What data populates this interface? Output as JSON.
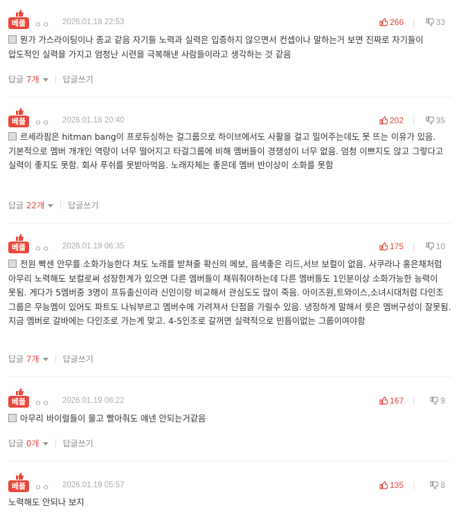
{
  "comments": [
    {
      "badge": "베플",
      "nick": "ㅇㅇ",
      "date": "2026.01.18 22:53",
      "up": "266",
      "down": "33",
      "text": "뭔가 가스라이팅이나 종교 같음 자기들 노력과 실력은 입증하지 않으면서 컨셉이나 말하는거 보면 진짜로 자기들이 압도적인 실력을 가지고 엄청난 시련을 극복해낸 사람들이라고 생각하는 것 같음",
      "reply_label": "답글",
      "reply_count": "7개",
      "write_label": "답글쓰기"
    },
    {
      "badge": "베플",
      "nick": "ㅇㅇ",
      "date": "2026.01.18 20:40",
      "up": "202",
      "down": "35",
      "text": "르세라핌은 hitman bang이 프로듀싱하는 걸그룹으로 하이브에서도 사활을 걸고 밀어주는데도 못 뜨는 이유가 있음. 기본적으로 멤버 개개인 역량이 너무 떨어지고 타걸그룹에 비해 멤버들이 경쟁성이 너무 없음. 엄청 이쁘지도 않고 그렇다고 실력이 좋지도 못함. 회사 푸쉬를 못받아먹음. 노래자체는 좋은데 멤버 반이상이 소화를 못함",
      "reply_label": "답글",
      "reply_count": "22개",
      "write_label": "답글쓰기"
    },
    {
      "badge": "베플",
      "nick": "ㅇㅇ",
      "date": "2026.01.19 06:35",
      "up": "175",
      "down": "10",
      "text": "전원 빡센 안무를 소화가능한다 쳐도 노래를 받쳐줄 확신의 메보, 음색좋은 리드,서브 보컬이 없음. 사쿠라나 홍은채처럼 아무리 노력해도 보컬로써 성장한계가 있으면 다른 멤버들이 채워줘야하는데 다른 멤버들도 1인분이상 소화가능한 능력이 못됨. 게다가 5멤버중 3명이 프듀출신이라 신인이랑 비교해서 관심도도 많이 죽음. 아이즈원,트와이스,소녀시대처럼 다인조 그룹은 무능멤이 있어도 파트도 나눠부르고 멤버수에 가려져서 단점을 가릴수 있음. 냉정하게 말해서 릇은 멤버구성이 잘못됨. 지금 멤버로 갈바에는 다인조로 가는게 맞고. 4-5인조로 갈꺼면 실력적으로 빈틈이없는 그룹이여야함",
      "reply_label": "답글",
      "reply_count": "7개",
      "write_label": "답글쓰기"
    },
    {
      "badge": "베플",
      "nick": "ㅇㅇ",
      "date": "2026.01.19 08:22",
      "up": "167",
      "down": "9",
      "text": "아무리 바이럴들이 물고 빨아줘도 얘넨 안되는거같음",
      "reply_label": "답글",
      "reply_count": "0개",
      "write_label": "답글쓰기"
    },
    {
      "badge": "베플",
      "nick": "ㅇㅇ",
      "date": "2026.01.19 05:57",
      "up": "135",
      "down": "8",
      "text": "노력해도 안되나 보지"
    }
  ],
  "colors": {
    "badge": "#e8473a",
    "up": "#e0463b",
    "muted": "#999999"
  }
}
